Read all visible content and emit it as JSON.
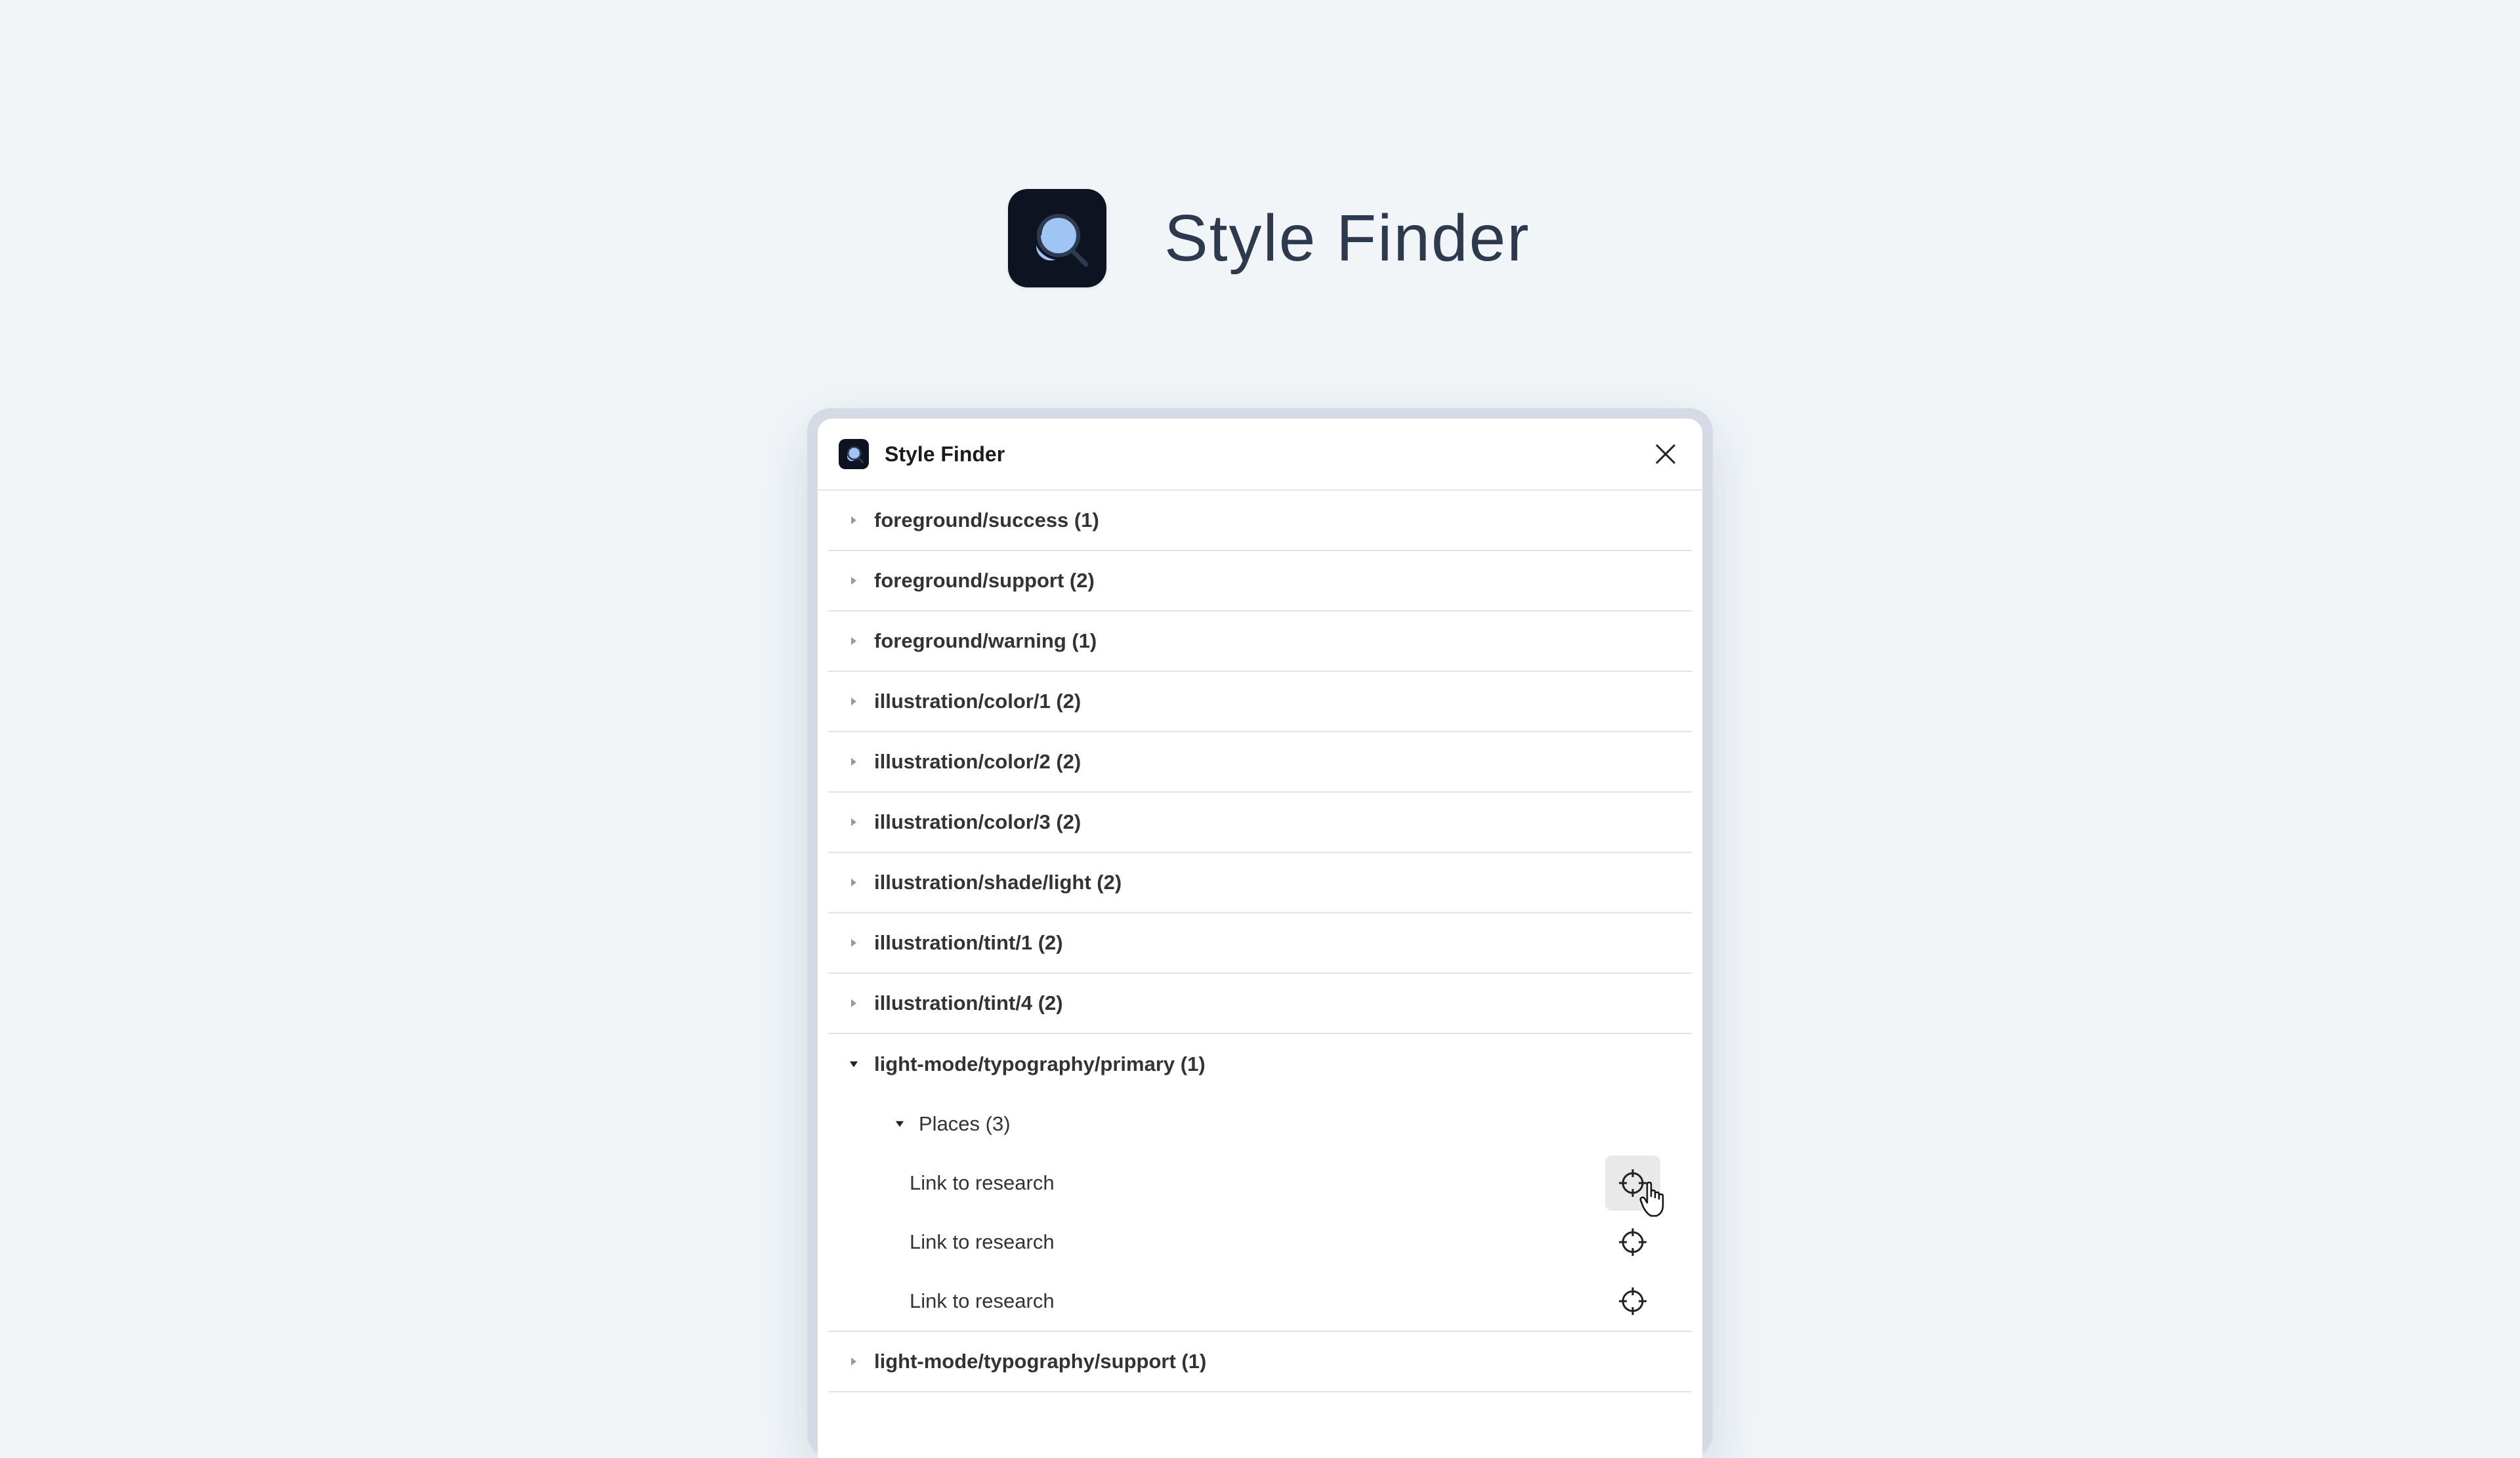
{
  "hero": {
    "title": "Style Finder",
    "icon": "style-finder-logo"
  },
  "plugin": {
    "title": "Style Finder",
    "icon": "style-finder-logo",
    "close_icon": "close-icon",
    "groups": [
      {
        "label": "foreground/success (1)"
      },
      {
        "label": "foreground/support (2)"
      },
      {
        "label": "foreground/warning (1)"
      },
      {
        "label": "illustration/color/1 (2)"
      },
      {
        "label": "illustration/color/2 (2)"
      },
      {
        "label": "illustration/color/3 (2)"
      },
      {
        "label": "illustration/shade/light (2)"
      },
      {
        "label": "illustration/tint/1 (2)"
      },
      {
        "label": "illustration/tint/4 (2)"
      }
    ],
    "expanded": {
      "label": "light-mode/typography/primary (1)",
      "sub": {
        "label": "Places (3)",
        "items": [
          {
            "label": "Link to research",
            "icon": "crosshair-icon"
          },
          {
            "label": "Link to research",
            "icon": "crosshair-icon"
          },
          {
            "label": "Link to research",
            "icon": "crosshair-icon"
          }
        ]
      }
    },
    "next_group": {
      "label": "light-mode/typography/support (1)"
    }
  },
  "colors": {
    "background": "#f1f5f8",
    "icon_bg": "#0d1320",
    "accent": "#9ec5f4",
    "title_text": "#2d3a4e"
  }
}
